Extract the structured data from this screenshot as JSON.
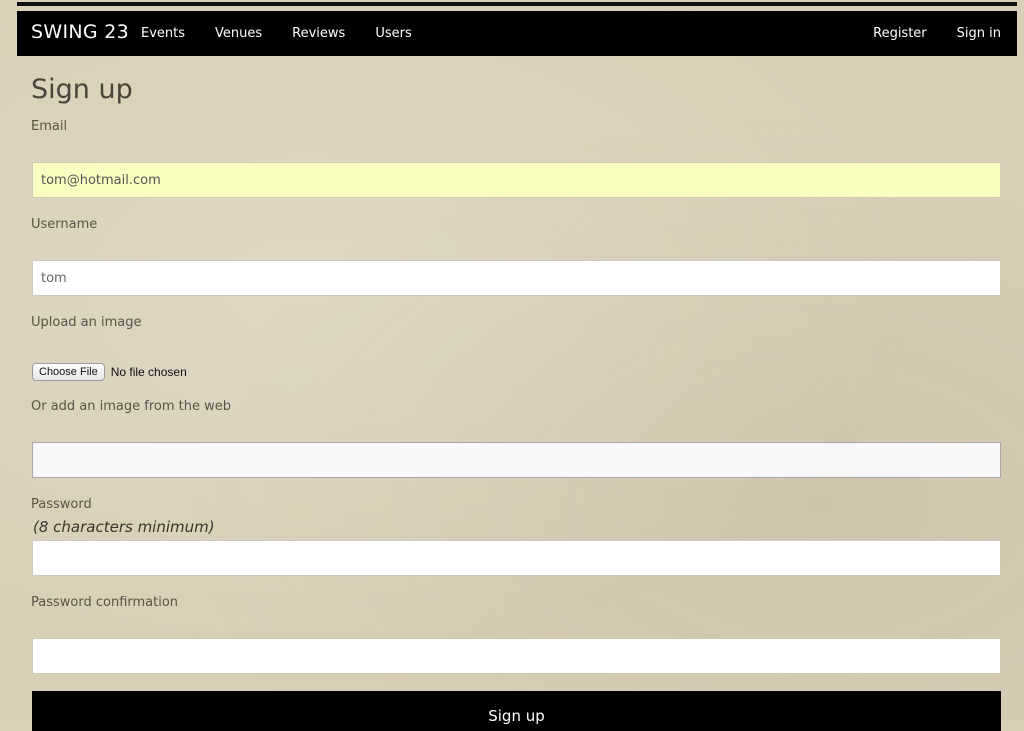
{
  "navbar": {
    "brand": "SWING 23",
    "left_items": [
      "Events",
      "Venues",
      "Reviews",
      "Users"
    ],
    "right_items": [
      "Register",
      "Sign in"
    ]
  },
  "form": {
    "title": "Sign up",
    "email": {
      "label": "Email",
      "value": "tom@hotmail.com"
    },
    "username": {
      "label": "Username",
      "value": "tom"
    },
    "upload": {
      "label": "Upload an image",
      "button": "Choose File",
      "status": "No file chosen"
    },
    "web_image": {
      "label": "Or add an image from the web",
      "value": ""
    },
    "password": {
      "label": "Password",
      "note": "(8 characters minimum)",
      "value": ""
    },
    "password_confirmation": {
      "label": "Password confirmation",
      "value": ""
    },
    "submit_label": "Sign up"
  },
  "colors": {
    "navbar_bg": "#000000",
    "autofill_bg": "#fbffc2",
    "page_bg": "#d9cfb7"
  }
}
